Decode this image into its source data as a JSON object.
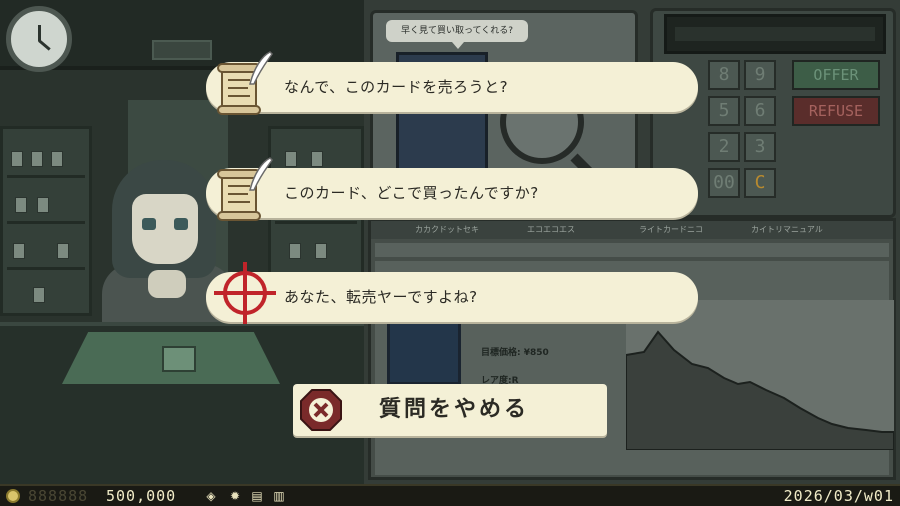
{
  "scene": {
    "npc_bubble": "早く見て買い取ってくれる?",
    "register_keys": [
      "8",
      "9",
      "5",
      "6",
      "2",
      "3",
      "00",
      "C"
    ],
    "offer_label": "OFFER",
    "refuse_label": "REFUSE",
    "browser_tabs": [
      "カカクドットセキ",
      "エコエコエス",
      "ライトカードニコ",
      "カイトリマニュアル"
    ],
    "browser_price": "目標価格: ¥850",
    "browser_rarity": "レア度:R"
  },
  "dialogue": {
    "options": [
      {
        "text": "なんで、このカードを売ろうと?",
        "icon": "scroll-quill-icon"
      },
      {
        "text": "このカード、どこで買ったんですか?",
        "icon": "scroll-quill-icon"
      },
      {
        "text": "あなた、転売ヤーですよね?",
        "icon": "crosshair-icon"
      }
    ],
    "stop_label": "質問をやめる",
    "stop_icon": "cancel-x-icon"
  },
  "status": {
    "money_placeholder": "888888",
    "money": "500,000",
    "date": "2026/03/w01"
  },
  "colors": {
    "bubble_bg": "#f4f0d6",
    "crosshair": "#c0242a",
    "stop_icon": "#7a2a2a",
    "status_text": "#f1ecc8"
  }
}
